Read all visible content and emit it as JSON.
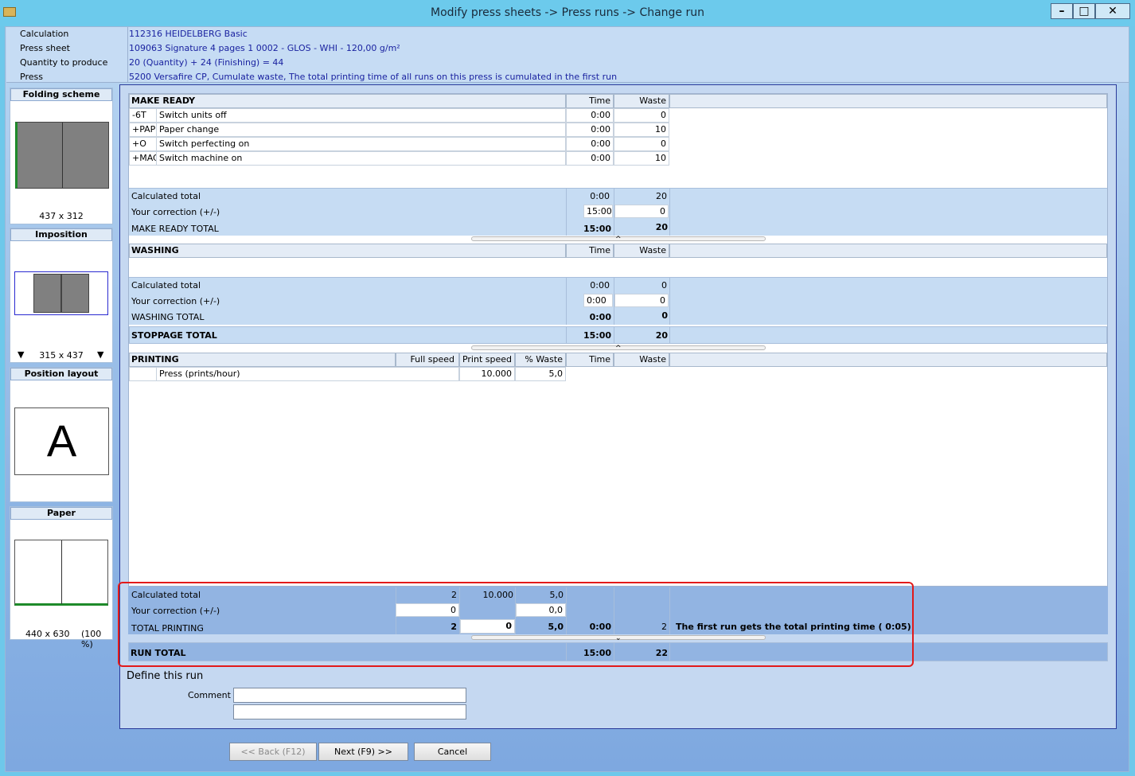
{
  "window": {
    "title": "Modify press sheets -> Press runs -> Change run",
    "btn_min": "–",
    "btn_max": "□",
    "btn_close": "✕"
  },
  "info": {
    "rows": [
      {
        "label": "Calculation",
        "value": "112316 HEIDELBERG Basic"
      },
      {
        "label": "Press sheet",
        "value": "109063 Signature 4 pages 1 0002  - GLOS - WHI - 120,00 g/m²"
      },
      {
        "label": "Quantity to produce",
        "value": "20 (Quantity) + 24 (Finishing) = 44"
      },
      {
        "label": "Press",
        "value": "5200 Versafire CP, Cumulate waste, The total printing time of all runs on this press is cumulated in the first run"
      }
    ]
  },
  "left": {
    "folding": {
      "title": "Folding scheme",
      "size": "437 x 312"
    },
    "imposition": {
      "title": "Imposition",
      "size": "315 x 437"
    },
    "position": {
      "title": "Position layout",
      "letter": "A"
    },
    "paper": {
      "title": "Paper",
      "size": "440 x 630",
      "percent": "(100 %)"
    }
  },
  "makeready": {
    "title": "MAKE READY",
    "col_time": "Time",
    "col_waste": "Waste",
    "rows": [
      {
        "code": "-6T",
        "desc": "Switch units off",
        "time": "0:00",
        "waste": "0"
      },
      {
        "code": "+PAP",
        "desc": "Paper change",
        "time": "0:00",
        "waste": "10"
      },
      {
        "code": "+O",
        "desc": "Switch perfecting on",
        "time": "0:00",
        "waste": "0"
      },
      {
        "code": "+MAC",
        "desc": "Switch machine on",
        "time": "0:00",
        "waste": "10"
      }
    ],
    "calc_label": "Calculated total",
    "calc_time": "0:00",
    "calc_waste": "20",
    "corr_label": "Your correction (+/-)",
    "corr_time": "15:00",
    "corr_waste": "0",
    "total_label": "MAKE READY TOTAL",
    "total_time": "15:00",
    "total_waste": "20"
  },
  "washing": {
    "title": "WASHING",
    "col_time": "Time",
    "col_waste": "Waste",
    "calc_label": "Calculated total",
    "calc_time": "0:00",
    "calc_waste": "0",
    "corr_label": "Your correction (+/-)",
    "corr_time": "0:00",
    "corr_waste": "0",
    "total_label": "WASHING TOTAL",
    "total_time": "0:00",
    "total_waste": "0"
  },
  "stoppage": {
    "label": "STOPPAGE TOTAL",
    "time": "15:00",
    "waste": "20"
  },
  "printing": {
    "title": "PRINTING",
    "col_full": "Full speed",
    "col_print": "Print speed",
    "col_pwaste": "% Waste",
    "col_time": "Time",
    "col_waste": "Waste",
    "row": {
      "desc": "Press   (prints/hour)",
      "print_speed": "10.000",
      "pwaste": "5,0"
    },
    "calc_label": "Calculated total",
    "calc_full": "2",
    "calc_print": "10.000",
    "calc_pwaste": "5,0",
    "corr_label": "Your correction (+/-)",
    "corr_full": "0",
    "corr_pwaste": "0,0",
    "total_label": "TOTAL PRINTING",
    "total_full": "2",
    "total_print": "0",
    "total_pwaste": "5,0",
    "total_time": "0:00",
    "total_waste": "2",
    "note": "The first run gets the total printing time (  0:05)"
  },
  "runtotal": {
    "label": "RUN TOTAL",
    "time": "15:00",
    "waste": "22"
  },
  "define": {
    "title": "Define this run",
    "comment_label": "Comment",
    "comment_value": "",
    "comment2_value": ""
  },
  "buttons": {
    "back": "<< Back (F12)",
    "next": "Next (F9) >>",
    "cancel": "Cancel"
  }
}
